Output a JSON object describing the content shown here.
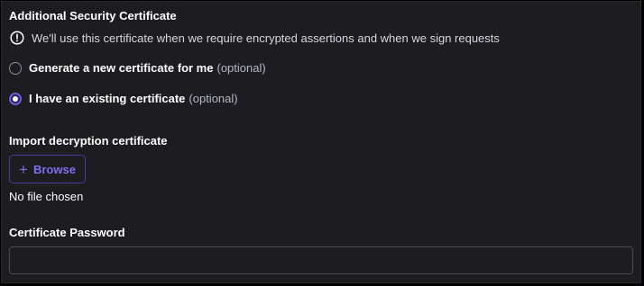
{
  "section": {
    "title": "Additional Security Certificate",
    "info": "We'll use this certificate when we require encrypted assertions and when we sign requests"
  },
  "options": [
    {
      "label": "Generate a new certificate for me",
      "optional": "(optional)",
      "selected": false
    },
    {
      "label": "I have an existing certificate",
      "optional": "(optional)",
      "selected": true
    }
  ],
  "import": {
    "label": "Import decryption certificate",
    "button_label": "Browse",
    "button_icon": "plus-icon",
    "file_status": "No file chosen"
  },
  "password": {
    "label": "Certificate Password",
    "value": "",
    "placeholder": ""
  },
  "colors": {
    "background": "#1c1c21",
    "accent": "#6f5bd8",
    "text": "#ffffff",
    "muted_text": "#b7b7c0",
    "border": "#4b4b52"
  }
}
